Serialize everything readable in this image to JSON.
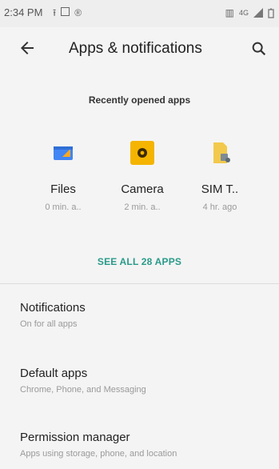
{
  "status_bar": {
    "time": "2:34 PM",
    "network_label": "4G"
  },
  "header": {
    "title": "Apps & notifications",
    "back_icon": "arrow-back-icon",
    "search_icon": "search-icon"
  },
  "recent": {
    "header": "Recently opened apps",
    "apps": [
      {
        "name": "Files",
        "time": "0 min. a..",
        "icon": "files-app-icon"
      },
      {
        "name": "Camera",
        "time": "2 min. a..",
        "icon": "camera-app-icon"
      },
      {
        "name": "SIM T..",
        "time": "4 hr. ago",
        "icon": "sim-toolkit-app-icon"
      }
    ],
    "see_all": "SEE ALL 28 APPS"
  },
  "settings": [
    {
      "title": "Notifications",
      "subtitle": "On for all apps"
    },
    {
      "title": "Default apps",
      "subtitle": "Chrome, Phone, and Messaging"
    },
    {
      "title": "Permission manager",
      "subtitle": "Apps using storage, phone, and location"
    }
  ],
  "colors": {
    "accent": "#2a9a8a",
    "camera": "#f4b400",
    "files_blue": "#4285f4"
  }
}
